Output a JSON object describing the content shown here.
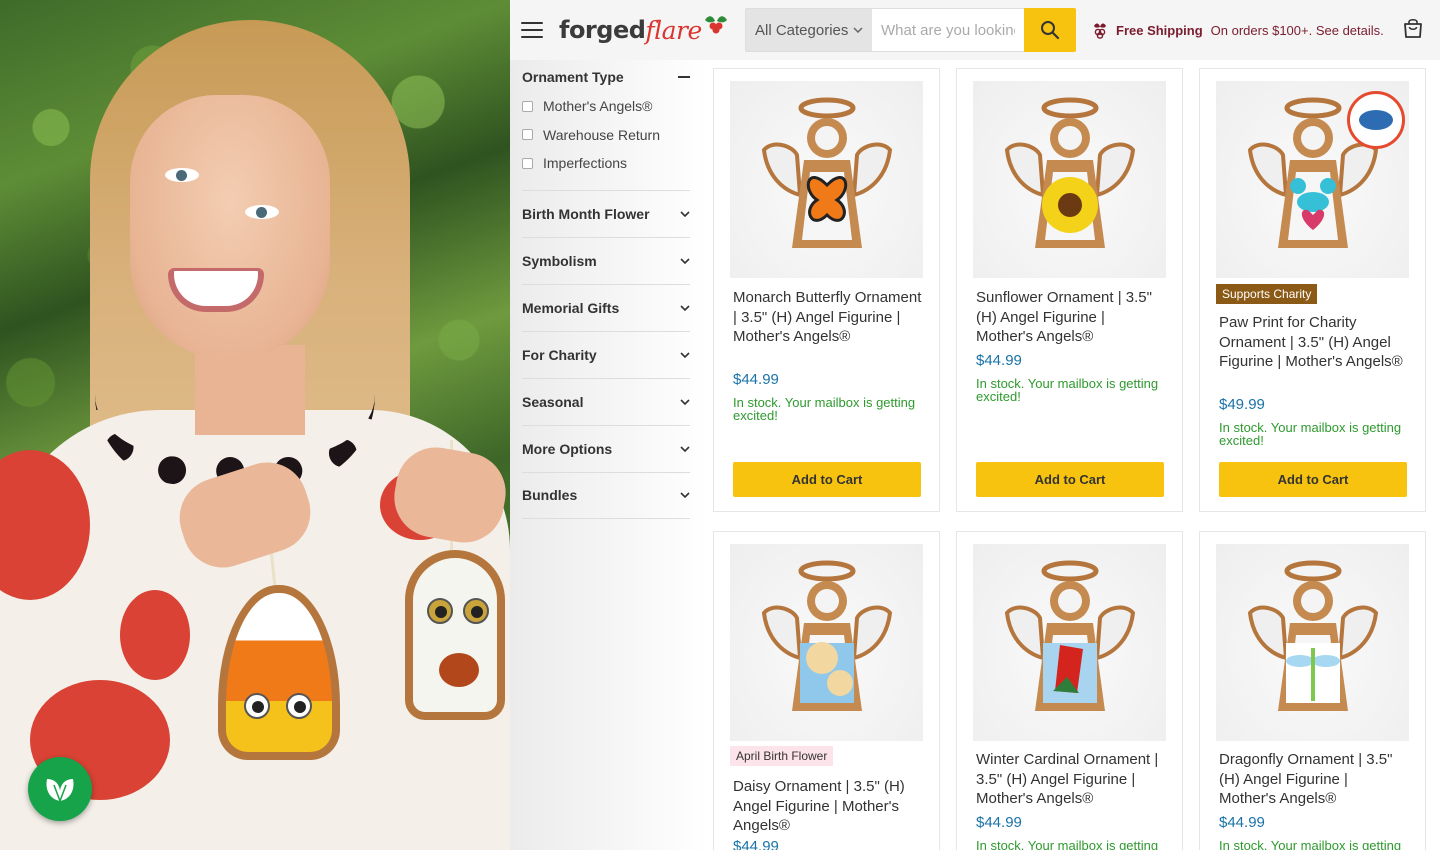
{
  "header": {
    "logo_part1": "forged",
    "logo_part2": "flare",
    "search": {
      "category": "All Categories",
      "placeholder": "What are you looking for?"
    },
    "promo": {
      "bold": "Free Shipping",
      "text": "On orders $100+. See details."
    }
  },
  "sidebar": {
    "open_filter": {
      "title": "Ornament Type",
      "options": [
        "Mother's Angels®",
        "Warehouse Return",
        "Imperfections"
      ]
    },
    "filters": [
      "Birth Month Flower",
      "Symbolism",
      "Memorial Gifts",
      "For Charity",
      "Seasonal",
      "More Options",
      "Bundles"
    ]
  },
  "products": [
    {
      "title": "Monarch Butterfly Ornament | 3.5\" (H) Angel Figurine | Mother's Angels®",
      "price": "$44.99",
      "stock": "In stock. Your mailbox is getting excited!",
      "cta": "Add to Cart",
      "art": "butterfly",
      "colors": [
        "#f07a18",
        "#222222"
      ]
    },
    {
      "title": "Sunflower Ornament | 3.5\" (H) Angel Figurine | Mother's Angels®",
      "price": "$44.99",
      "stock": "In stock. Your mailbox is getting excited!",
      "cta": "Add to Cart",
      "art": "sunflower",
      "colors": [
        "#f4d21a",
        "#6b3a12"
      ]
    },
    {
      "title": "Paw Print for Charity Ornament | 3.5\" (H) Angel Figurine | Mother's Angels®",
      "price": "$49.99",
      "stock": "In stock. Your mailbox is getting excited!",
      "cta": "Add to Cart",
      "badge": "Supports Charity",
      "art": "paw",
      "colors": [
        "#36c0d8",
        "#d83a6a"
      ]
    },
    {
      "title": "Daisy Ornament | 3.5\" (H) Angel Figurine | Mother's Angels®",
      "price": "$44.99",
      "badge": "April Birth Flower",
      "art": "daisy",
      "colors": [
        "#8fc8ea",
        "#f2d7a0"
      ]
    },
    {
      "title": "Winter Cardinal Ornament | 3.5\" (H) Angel Figurine | Mother's Angels®",
      "price": "$44.99",
      "stock": "In stock. Your mailbox is getting excited!",
      "art": "cardinal",
      "colors": [
        "#d3241e",
        "#2e7d3a"
      ]
    },
    {
      "title": "Dragonfly Ornament | 3.5\" (H) Angel Figurine | Mother's Angels®",
      "price": "$44.99",
      "stock": "In stock. Your mailbox is getting excited!",
      "art": "dragonfly",
      "colors": [
        "#a6d8f2",
        "#7ec850"
      ]
    }
  ],
  "icons": {
    "menu": "hamburger-menu-icon",
    "search": "magnifier-icon",
    "cart": "shopping-bag-icon",
    "chat": "leaf-chat-icon",
    "promo": "holly-truck-icon"
  },
  "colors": {
    "accent_yellow": "#f7c30f",
    "brand_red": "#d9362f",
    "price_blue": "#1a73a8",
    "stock_green": "#2e9a2e",
    "promo_maroon": "#7a1c2e"
  }
}
